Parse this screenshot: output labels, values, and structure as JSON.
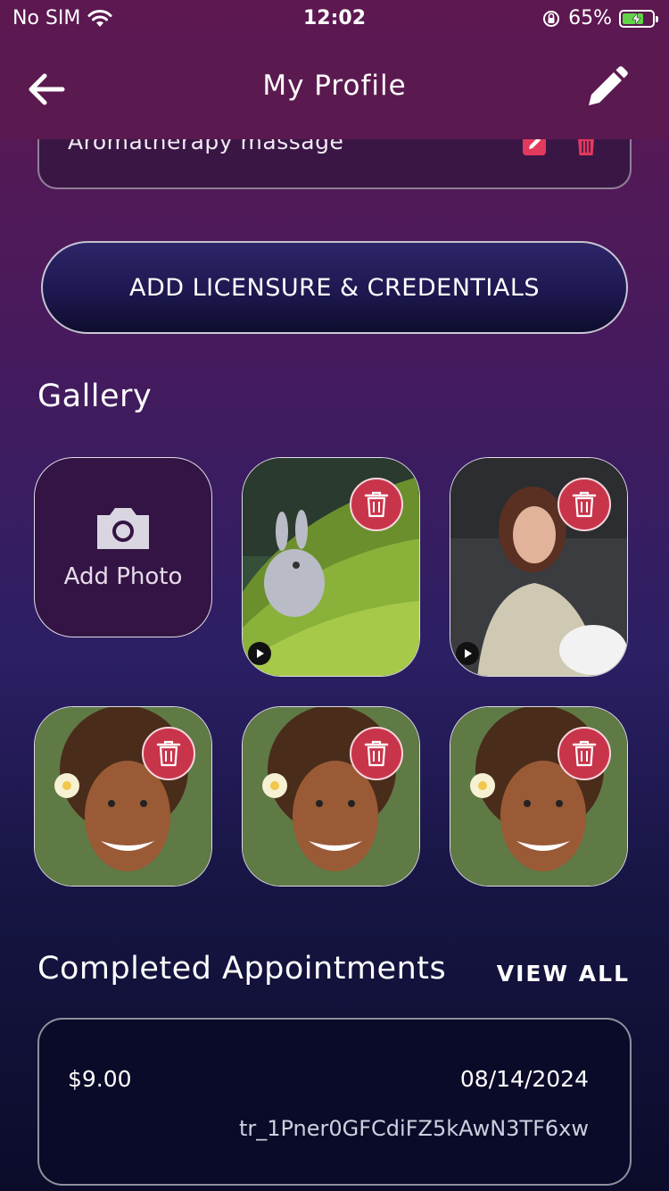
{
  "status_bar": {
    "carrier": "No SIM",
    "time": "12:02",
    "battery": "65%"
  },
  "header": {
    "title": "My Profile"
  },
  "service": {
    "name": "Aromatherapy massage"
  },
  "licensure_button": "ADD LICENSURE & CREDENTIALS",
  "gallery": {
    "title": "Gallery",
    "add_photo": "Add Photo"
  },
  "appointments": {
    "title": "Completed Appointments",
    "view_all": "VIEW ALL",
    "items": [
      {
        "amount": "$9.00",
        "date": "08/14/2024",
        "id": "tr_1Pner0GFCdiFZ5kAwN3TF6xw"
      }
    ]
  },
  "colors": {
    "delete_badge": "#c8354b",
    "header": "#5b1a4f",
    "accent_edit": "#e23a5c"
  }
}
